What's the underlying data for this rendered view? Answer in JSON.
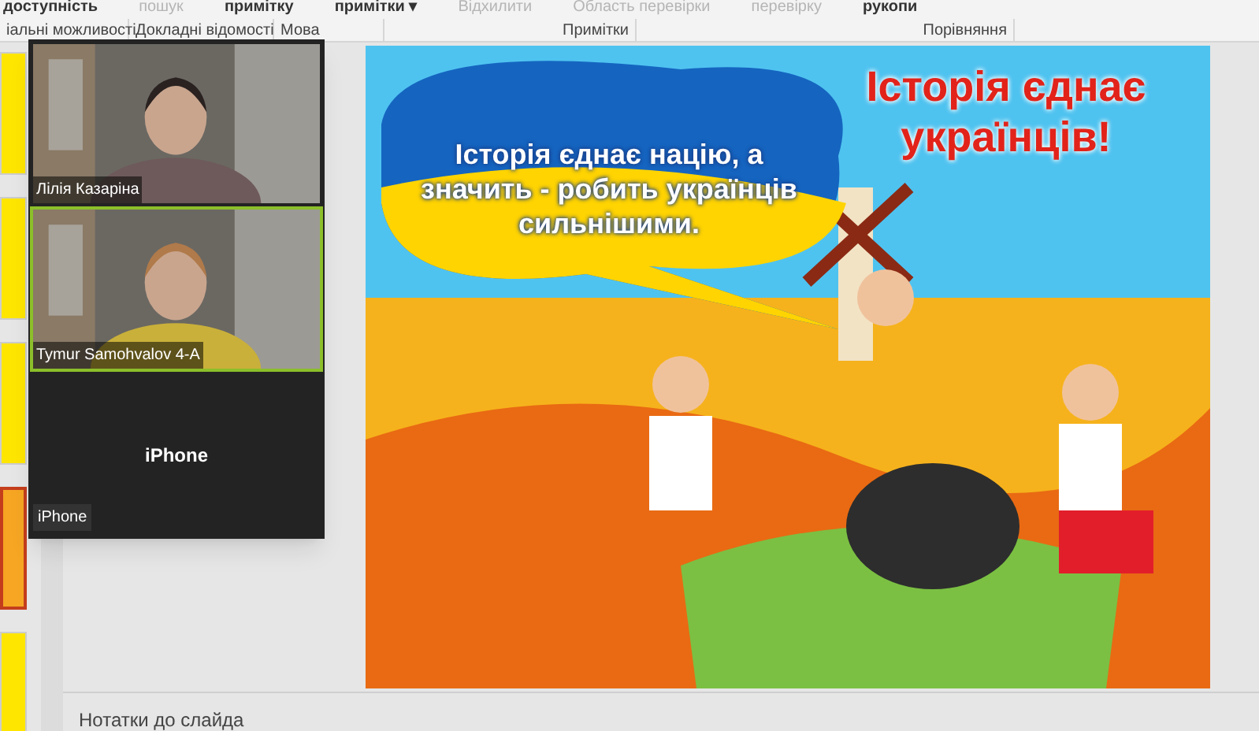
{
  "ribbon": {
    "commands": [
      {
        "label": "доступність",
        "disabled": false
      },
      {
        "label": "пошук",
        "disabled": true
      },
      {
        "label": "примітку",
        "disabled": false
      },
      {
        "label": "примітки ▾",
        "disabled": false
      },
      {
        "label": "Відхилити",
        "disabled": true
      },
      {
        "label": "Область перевірки",
        "disabled": true
      },
      {
        "label": "перевірку",
        "disabled": true
      },
      {
        "label": "рукопи",
        "disabled": false
      }
    ],
    "groups": [
      "іальні можливості",
      "Докладні відомості",
      "Мова",
      "Примітки",
      "Порівняння"
    ]
  },
  "thumbnails": [
    {
      "selected": false
    },
    {
      "selected": false
    },
    {
      "selected": false
    },
    {
      "selected": true
    },
    {
      "selected": false
    }
  ],
  "video_panel": {
    "participants": [
      {
        "name": "Лілія Казаріна",
        "kind": "camera",
        "speaking": false
      },
      {
        "name": "Tymur Samohvalov 4-A",
        "kind": "camera",
        "speaking": true
      },
      {
        "name": "iPhone",
        "kind": "no_video",
        "caption": "iPhone",
        "speaking": false
      }
    ]
  },
  "slide": {
    "title": "Історія єднає українців!",
    "bubble": "Історія єднає націю, а значить - робить українців сильнішими."
  },
  "notes": {
    "label": "Нотатки до слайда"
  }
}
